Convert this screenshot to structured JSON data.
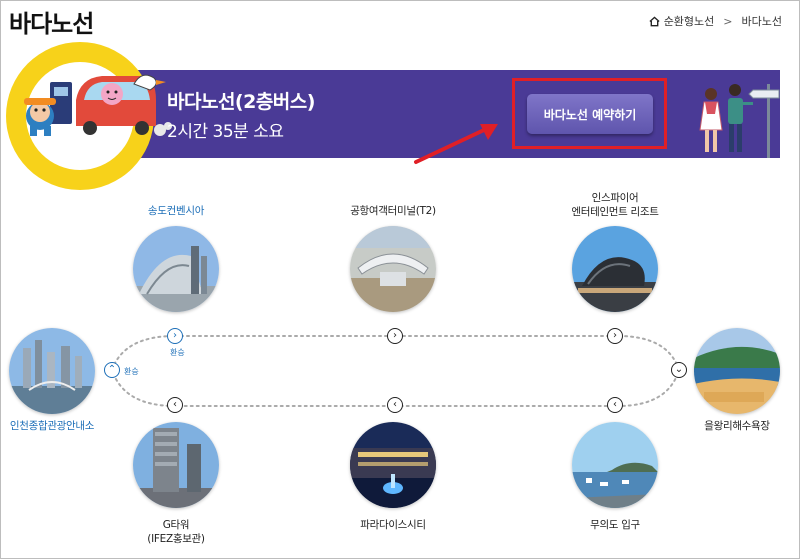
{
  "header": {
    "title": "바다노선",
    "breadcrumb": {
      "parent": "순환형노선",
      "separator": ">",
      "current": "바다노선"
    }
  },
  "banner": {
    "title": "바다노선(2층버스)",
    "subtitle": "2시간 35분 소요",
    "reserve_label": "바다노선 예약하기",
    "colors": {
      "background": "#4a3a96",
      "accent_circle": "#f7d21a",
      "highlight": "#e01f26"
    }
  },
  "route": {
    "transfer_label": "환승",
    "stations": {
      "incheon_info": "인천종합관광안내소",
      "songdo": "송도컨벤시아",
      "airport_t2": "공항여객터미널(T2)",
      "inspire": [
        "인스파이어",
        "엔터테인먼트 리조트"
      ],
      "eurwangni": "을왕리해수욕장",
      "muuido": "무의도 입구",
      "paradise": "파라다이스시티",
      "gtower": [
        "G타워",
        "(IFEZ홍보관)"
      ]
    },
    "arrow_icons": {
      "right": "›",
      "left": "‹",
      "down": "⌄",
      "up": "⌃"
    }
  }
}
